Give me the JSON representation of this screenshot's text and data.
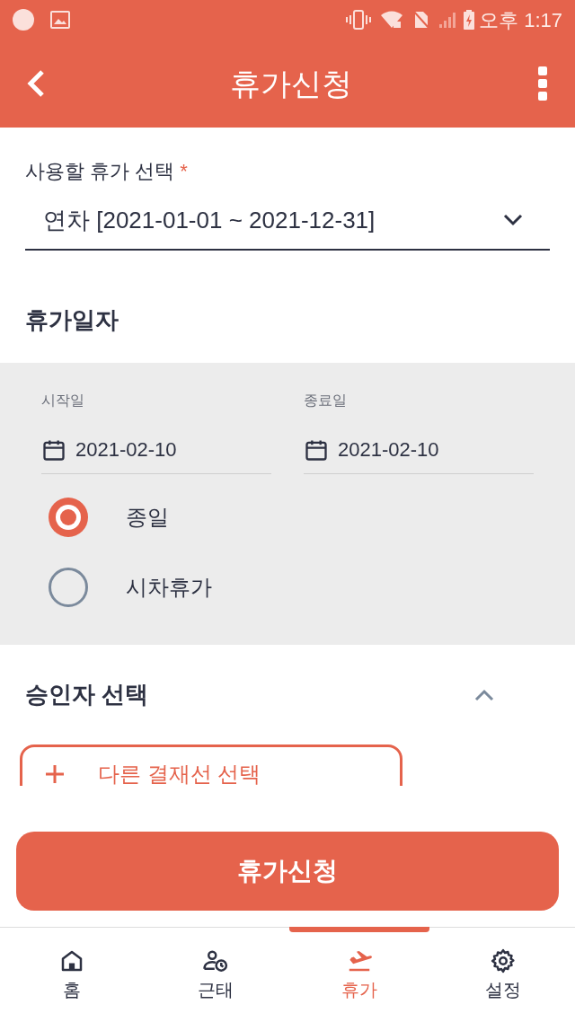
{
  "status_bar": {
    "time": "오후 1:17"
  },
  "app_bar": {
    "title": "휴가신청"
  },
  "leave_type": {
    "label": "사용할 휴가 선택",
    "required_mark": "*",
    "value": "연차 [2021-01-01 ~ 2021-12-31]"
  },
  "leave_dates": {
    "title": "휴가일자",
    "start": {
      "label": "시작일",
      "value": "2021-02-10"
    },
    "end": {
      "label": "종료일",
      "value": "2021-02-10"
    },
    "options": [
      {
        "label": "종일",
        "selected": true
      },
      {
        "label": "시차휴가",
        "selected": false
      }
    ]
  },
  "approver": {
    "title": "승인자 선택",
    "expanded": true,
    "add_button": "다른 결재선 선택"
  },
  "submit_button": "휴가신청",
  "nav": [
    {
      "kind": "home",
      "label": "홈",
      "selected": false
    },
    {
      "kind": "attendance",
      "label": "근태",
      "selected": false
    },
    {
      "kind": "leave",
      "label": "휴가",
      "selected": true
    },
    {
      "kind": "settings",
      "label": "설정",
      "selected": false
    }
  ]
}
